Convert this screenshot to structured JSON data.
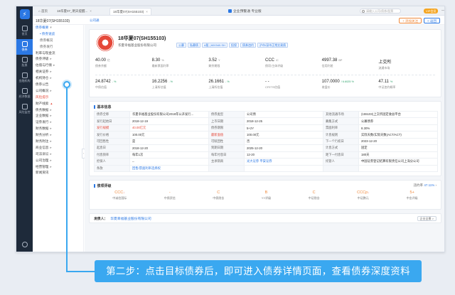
{
  "darkbar": {
    "items": [
      {
        "label": "首页",
        "icon": "home-icon"
      },
      {
        "label": "债券",
        "icon": "bond-icon"
      },
      {
        "label": "股票",
        "icon": "stock-icon"
      },
      {
        "label": "金融机构",
        "icon": "institution-icon"
      },
      {
        "label": "经济数据",
        "icon": "economy-icon"
      },
      {
        "label": "风险监控",
        "icon": "risk-icon"
      }
    ]
  },
  "tabs": [
    {
      "label": "首页"
    },
    {
      "label": "18华夏07_明天提醒..."
    },
    {
      "label": "18华夏07(SH155103)"
    }
  ],
  "app": {
    "title": "企业预警通 专业版",
    "search_placeholder": "请输入公司/债券/股票",
    "vip": "VIP会员"
  },
  "subheader": {
    "name": "18华夏07(SH155103)",
    "link": "公司通",
    "watch": "+ 添加关注",
    "back": "< 返回"
  },
  "nav": [
    {
      "label": "债券概要",
      "type": "group",
      "caret": "▾"
    },
    {
      "label": "• 债券速览",
      "type": "sub active"
    },
    {
      "label": "债券概况",
      "type": "sub"
    },
    {
      "label": "债券发行",
      "type": "sub"
    },
    {
      "label": "利率与现金流",
      "type": ""
    },
    {
      "label": "债券评级",
      "type": "",
      "caret": "▸"
    },
    {
      "label": "估值与行情",
      "type": "",
      "caret": "▸"
    },
    {
      "label": "相关证券",
      "type": "",
      "caret": "▸"
    },
    {
      "label": "机构持仓",
      "type": "",
      "caret": "▸"
    },
    {
      "label": "债券公告",
      "type": ""
    },
    {
      "label": "公司概况",
      "type": "",
      "caret": "▸"
    },
    {
      "label": "风险提示",
      "type": "red"
    },
    {
      "label": "财产线索",
      "type": "",
      "hot": "▲"
    },
    {
      "label": "债务数据",
      "type": "",
      "caret": "▸"
    },
    {
      "label": "企业数据",
      "type": "",
      "caret": "▸"
    },
    {
      "label": "证券发行",
      "type": "",
      "caret": "▸"
    },
    {
      "label": "财务数据",
      "type": "",
      "caret": "▸"
    },
    {
      "label": "财务分析",
      "type": "",
      "caret": "▸"
    },
    {
      "label": "财务附注",
      "type": "",
      "caret": "▸"
    },
    {
      "label": "商业信息",
      "type": "",
      "caret": "▸"
    },
    {
      "label": "司法诉讼",
      "type": "",
      "caret": "▸"
    },
    {
      "label": "公司治理",
      "type": "",
      "caret": "▸"
    },
    {
      "label": "经营管理",
      "type": "",
      "caret": "▸"
    },
    {
      "label": "新闻资讯",
      "type": ""
    }
  ],
  "bond": {
    "title": "18华夏07(SH155103)",
    "issuer": "华夏幸福基业股份有限公司",
    "tags": [
      "公募",
      "私募债",
      "A股 | 600340.SH",
      "担保",
      "债券违约",
      "沪市/深市正常交易债"
    ],
    "metrics_row1": [
      {
        "value": "40.00",
        "unit": "亿",
        "label": "债券余额"
      },
      {
        "value": "8.30",
        "unit": "%",
        "label": "最新票面利率"
      },
      {
        "value": "3.52",
        "unit": "Y",
        "label": "剩余期限"
      },
      {
        "value": "CCC",
        "unit": "/C",
        "label": "债项/主体评级"
      },
      {
        "value": "4997.38",
        "unit": "BP",
        "label": "信用利差"
      },
      {
        "value": "上交所",
        "unit": "",
        "label": "流通市场"
      }
    ],
    "metrics_row2": [
      {
        "value": "24.8742",
        "unit": "- %",
        "label": "中债估值"
      },
      {
        "value": "16.2256",
        "unit": "- %",
        "label": "上清所估值"
      },
      {
        "value": "26.1661",
        "unit": "- %",
        "label": "上清所估值"
      },
      {
        "value": "- -",
        "unit": "",
        "label": "CFETS估值"
      },
      {
        "value": "107.0000",
        "unit": "/ 6.6025 %",
        "label": "收盘价"
      },
      {
        "value": "47.11",
        "unit": "%",
        "label": "中证违约概率"
      }
    ]
  },
  "basic_info": {
    "title": "基本信息",
    "rows": [
      [
        "债券全称",
        "华夏幸福基业股份有限公司2018年公开发行...",
        "债券类型",
        "公司债",
        "其他流通市场",
        "(155103)上交所固定收益平台"
      ],
      [
        "发行起始日",
        "2018-12-19",
        "上市日期",
        "2018-12-25",
        "募集方式",
        "公募债券"
      ],
      [
        "发行规模",
        "40.00亿元",
        "债券期限",
        "5+2Y",
        "票面利率",
        "8.30%"
      ],
      [
        "发行价格",
        "100.00元",
        "最新面值",
        "100.00元",
        "计息规则",
        "实际天数/实际天数(ACT/ACT)"
      ],
      [
        "可回售性",
        "是",
        "可赎回性",
        "否",
        "下一个行权日",
        "2023-12-20"
      ],
      [
        "起息日",
        "2018-12-20",
        "到期日期",
        "2025-12-20",
        "计息方式",
        "固定"
      ],
      [
        "付息频率",
        "每年1次",
        "每年付息日",
        "12-20",
        "距下一付息日",
        "180天"
      ],
      [
        "担保人",
        "--",
        "主承销商",
        "光大证券  平安证券",
        "托管人",
        "中国证券登记结算有限责任公司上海分公司"
      ],
      [
        "条款",
        "回售/票面利率选择权",
        "",
        "",
        "",
        ""
      ]
    ]
  },
  "ratings": {
    "title": "债项评级",
    "link_label": "违约率",
    "link_value": "47.11%",
    "items": [
      {
        "value": "CCC",
        "up": "↓",
        "label": "中诚信国际"
      },
      {
        "value": "-",
        "up": "",
        "label": "中债资信"
      },
      {
        "value": "C",
        "up": "",
        "label": "中债隐含"
      },
      {
        "value": "B",
        "up": "",
        "label": "YY评级"
      },
      {
        "value": "C",
        "up": "",
        "label": "中证隐含"
      },
      {
        "value": "CCCp",
        "up": "↓",
        "label": "中证鹏元"
      },
      {
        "value": "5+",
        "up": "",
        "label": "中金评级"
      }
    ]
  },
  "issuer_section": {
    "label": "发债人：",
    "name": "华夏幸福基业股份有限公司",
    "button": "企业全景 >"
  },
  "caption": "第二步：点击目标债券后，即可进入债券详情页面，查看债券深度资料"
}
